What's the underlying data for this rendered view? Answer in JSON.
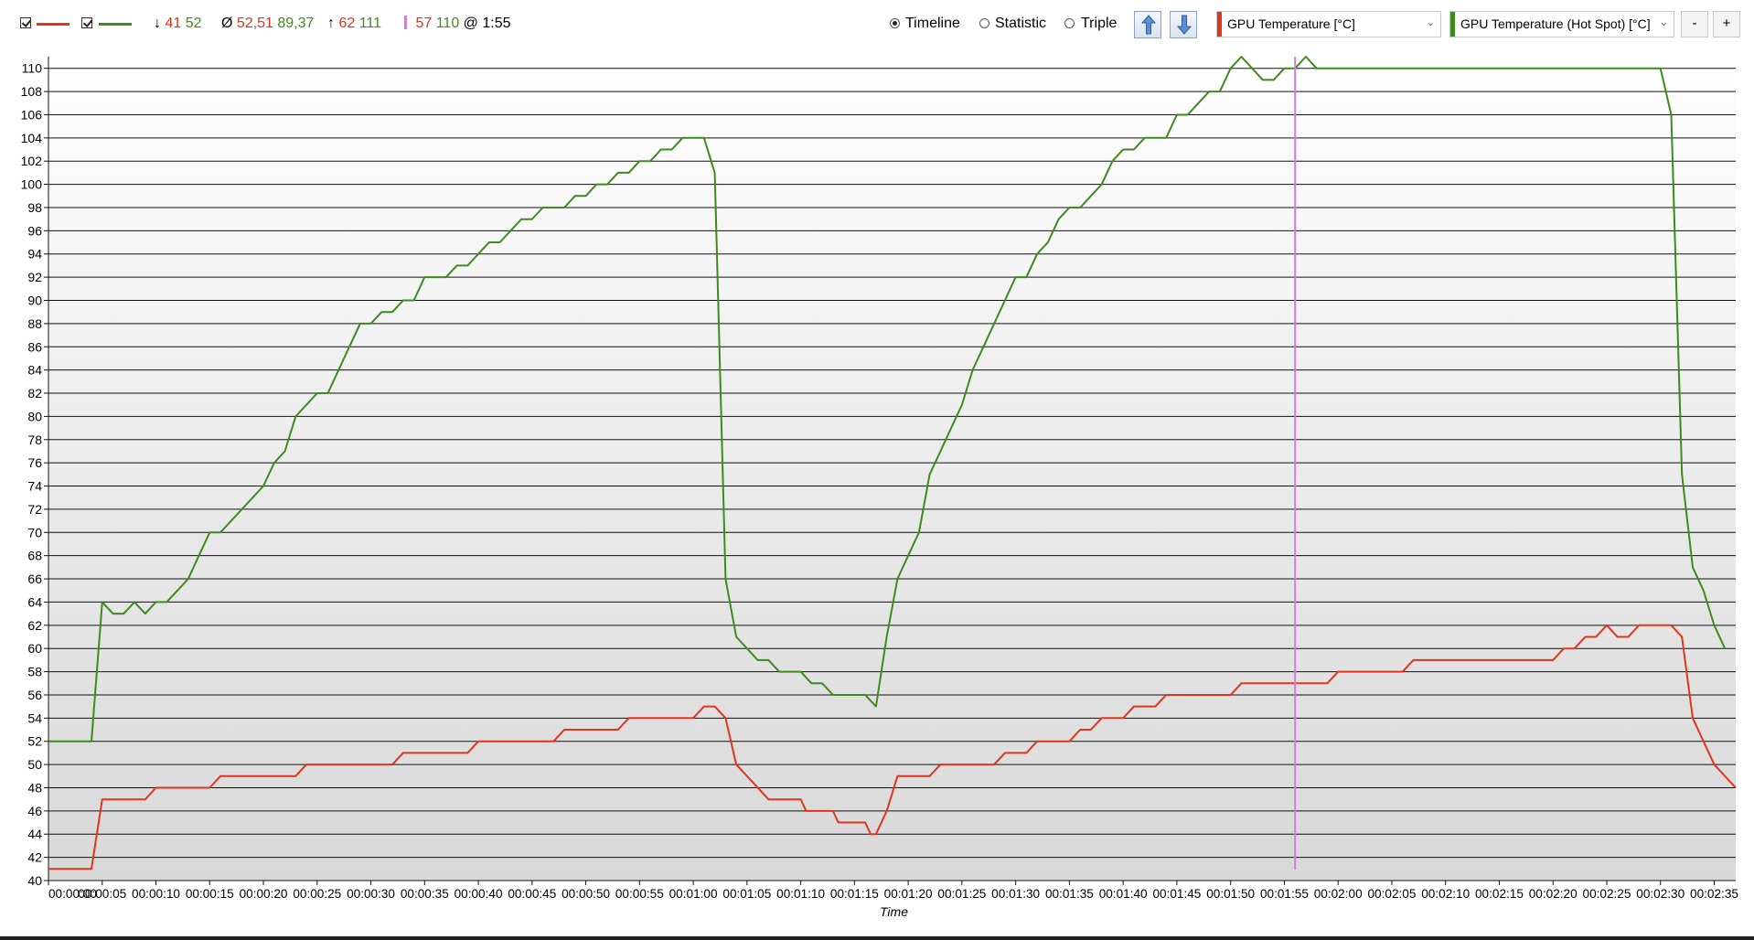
{
  "toolbar": {
    "stats": {
      "min_symbol": "↓",
      "min_a": "41",
      "min_b": "52",
      "avg_symbol": "Ø",
      "avg_a": "52,51",
      "avg_b": "89,37",
      "max_symbol": "↑",
      "max_a": "62",
      "max_b": "111",
      "cursor_a": "57",
      "cursor_b": "110",
      "cursor_at": "@ 1:55"
    },
    "modes": [
      {
        "label": "Timeline",
        "selected": true
      },
      {
        "label": "Statistic",
        "selected": false
      },
      {
        "label": "Triple",
        "selected": false
      }
    ],
    "up_icon": "arrow-up-icon",
    "down_icon": "arrow-down-icon",
    "sensor1": "GPU Temperature [°C]",
    "sensor2": "GPU Temperature (Hot Spot) [°C]",
    "zoom_out": "-",
    "zoom_in": "+"
  },
  "colors": {
    "series1": "#e0341c",
    "series2": "#3f8a1e",
    "cursor": "#d27fd8"
  },
  "chart_data": {
    "type": "line",
    "xlabel": "Time",
    "ylim": [
      40,
      111
    ],
    "y_ticks": [
      40,
      42,
      44,
      46,
      48,
      50,
      52,
      54,
      56,
      58,
      60,
      62,
      64,
      66,
      68,
      70,
      72,
      74,
      76,
      78,
      80,
      82,
      84,
      86,
      88,
      90,
      92,
      94,
      96,
      98,
      100,
      102,
      104,
      106,
      108,
      110
    ],
    "x_range_seconds": [
      0,
      157
    ],
    "x_tick_labels": [
      "00:00:00",
      "00:00:05",
      "00:00:10",
      "00:00:15",
      "00:00:20",
      "00:00:25",
      "00:00:30",
      "00:00:35",
      "00:00:40",
      "00:00:45",
      "00:00:50",
      "00:00:55",
      "00:01:00",
      "00:01:05",
      "00:01:10",
      "00:01:15",
      "00:01:20",
      "00:01:25",
      "00:01:30",
      "00:01:35",
      "00:01:40",
      "00:01:45",
      "00:01:50",
      "00:01:55",
      "00:02:00",
      "00:02:05",
      "00:02:10",
      "00:02:15",
      "00:02:20",
      "00:02:25",
      "00:02:30",
      "00:02:35"
    ],
    "cursor_seconds": 116,
    "series": [
      {
        "name": "GPU Temperature [°C]",
        "points": [
          [
            0,
            41
          ],
          [
            4,
            41
          ],
          [
            5,
            47
          ],
          [
            9,
            47
          ],
          [
            10,
            48
          ],
          [
            15,
            48
          ],
          [
            16,
            49
          ],
          [
            23,
            49
          ],
          [
            24,
            50
          ],
          [
            32,
            50
          ],
          [
            33,
            51
          ],
          [
            39,
            51
          ],
          [
            40,
            52
          ],
          [
            47,
            52
          ],
          [
            48,
            53
          ],
          [
            53,
            53
          ],
          [
            54,
            54
          ],
          [
            60,
            54
          ],
          [
            61,
            55
          ],
          [
            62,
            55
          ],
          [
            63,
            54
          ],
          [
            64,
            50
          ],
          [
            65,
            49
          ],
          [
            67,
            47
          ],
          [
            70,
            47
          ],
          [
            70.5,
            46
          ],
          [
            72,
            46
          ],
          [
            73,
            46
          ],
          [
            73.5,
            45
          ],
          [
            76,
            45
          ],
          [
            76.5,
            44
          ],
          [
            77,
            44
          ],
          [
            78,
            46
          ],
          [
            79,
            49
          ],
          [
            82,
            49
          ],
          [
            83,
            50
          ],
          [
            88,
            50
          ],
          [
            89,
            51
          ],
          [
            91,
            51
          ],
          [
            92,
            52
          ],
          [
            95,
            52
          ],
          [
            96,
            53
          ],
          [
            97,
            53
          ],
          [
            98,
            54
          ],
          [
            100,
            54
          ],
          [
            101,
            55
          ],
          [
            103,
            55
          ],
          [
            104,
            56
          ],
          [
            110,
            56
          ],
          [
            111,
            57
          ],
          [
            119,
            57
          ],
          [
            120,
            58
          ],
          [
            126,
            58
          ],
          [
            127,
            59
          ],
          [
            140,
            59
          ],
          [
            141,
            60
          ],
          [
            142,
            60
          ],
          [
            143,
            61
          ],
          [
            144,
            61
          ],
          [
            145,
            62
          ],
          [
            146,
            61
          ],
          [
            147,
            61
          ],
          [
            148,
            62
          ],
          [
            151,
            62
          ],
          [
            152,
            61
          ],
          [
            153,
            54
          ],
          [
            155,
            50
          ],
          [
            157,
            48
          ]
        ]
      },
      {
        "name": "GPU Temperature (Hot Spot) [°C]",
        "points": [
          [
            0,
            52
          ],
          [
            4,
            52
          ],
          [
            5,
            64
          ],
          [
            6,
            63
          ],
          [
            7,
            63
          ],
          [
            8,
            64
          ],
          [
            9,
            63
          ],
          [
            10,
            64
          ],
          [
            11,
            64
          ],
          [
            13,
            66
          ],
          [
            14,
            68
          ],
          [
            15,
            70
          ],
          [
            16,
            70
          ],
          [
            17,
            71
          ],
          [
            19,
            73
          ],
          [
            20,
            74
          ],
          [
            21,
            76
          ],
          [
            22,
            77
          ],
          [
            23,
            80
          ],
          [
            25,
            82
          ],
          [
            26,
            82
          ],
          [
            27,
            84
          ],
          [
            28,
            86
          ],
          [
            29,
            88
          ],
          [
            30,
            88
          ],
          [
            31,
            89
          ],
          [
            32,
            89
          ],
          [
            33,
            90
          ],
          [
            34,
            90
          ],
          [
            35,
            92
          ],
          [
            37,
            92
          ],
          [
            38,
            93
          ],
          [
            39,
            93
          ],
          [
            40,
            94
          ],
          [
            41,
            95
          ],
          [
            42,
            95
          ],
          [
            43,
            96
          ],
          [
            44,
            97
          ],
          [
            45,
            97
          ],
          [
            46,
            98
          ],
          [
            48,
            98
          ],
          [
            49,
            99
          ],
          [
            50,
            99
          ],
          [
            51,
            100
          ],
          [
            52,
            100
          ],
          [
            53,
            101
          ],
          [
            54,
            101
          ],
          [
            55,
            102
          ],
          [
            56,
            102
          ],
          [
            57,
            103
          ],
          [
            58,
            103
          ],
          [
            59,
            104
          ],
          [
            61,
            104
          ],
          [
            62,
            101
          ],
          [
            63,
            66
          ],
          [
            64,
            61
          ],
          [
            65,
            60
          ],
          [
            66,
            59
          ],
          [
            67,
            59
          ],
          [
            68,
            58
          ],
          [
            70,
            58
          ],
          [
            71,
            57
          ],
          [
            72,
            57
          ],
          [
            73,
            56
          ],
          [
            76,
            56
          ],
          [
            77,
            55
          ],
          [
            78,
            61
          ],
          [
            79,
            66
          ],
          [
            80,
            68
          ],
          [
            81,
            70
          ],
          [
            82,
            75
          ],
          [
            83,
            77
          ],
          [
            84,
            79
          ],
          [
            85,
            81
          ],
          [
            86,
            84
          ],
          [
            87,
            86
          ],
          [
            88,
            88
          ],
          [
            89,
            90
          ],
          [
            90,
            92
          ],
          [
            91,
            92
          ],
          [
            92,
            94
          ],
          [
            93,
            95
          ],
          [
            94,
            97
          ],
          [
            95,
            98
          ],
          [
            96,
            98
          ],
          [
            97,
            99
          ],
          [
            98,
            100
          ],
          [
            99,
            102
          ],
          [
            100,
            103
          ],
          [
            101,
            103
          ],
          [
            102,
            104
          ],
          [
            104,
            104
          ],
          [
            105,
            106
          ],
          [
            106,
            106
          ],
          [
            107,
            107
          ],
          [
            108,
            108
          ],
          [
            109,
            108
          ],
          [
            110,
            110
          ],
          [
            111,
            111
          ],
          [
            112,
            110
          ],
          [
            113,
            109
          ],
          [
            114,
            109
          ],
          [
            115,
            110
          ],
          [
            116,
            110
          ],
          [
            117,
            111
          ],
          [
            118,
            110
          ],
          [
            150,
            110
          ],
          [
            151,
            106
          ],
          [
            152,
            75
          ],
          [
            153,
            67
          ],
          [
            154,
            65
          ],
          [
            155,
            62
          ],
          [
            156,
            60
          ]
        ]
      }
    ]
  }
}
